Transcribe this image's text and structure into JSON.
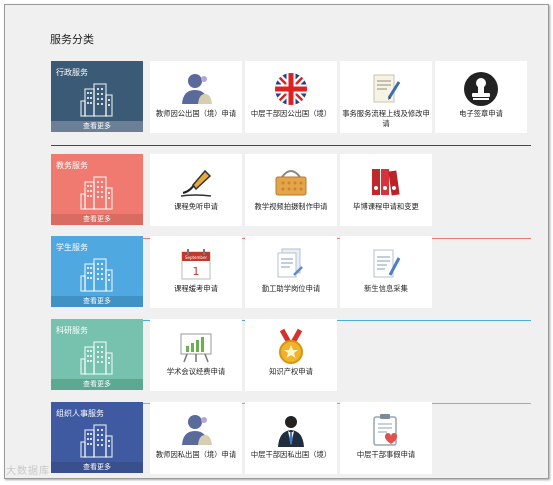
{
  "page_title": "服务分类",
  "sections": [
    {
      "name": "行政服务",
      "more": "查看更多",
      "color": "#3b5a76",
      "more_color": "#6b8096",
      "line_color": "#2f4f6c",
      "items": [
        {
          "label": "教师因公出国（境）申请",
          "icon": "person-icon"
        },
        {
          "label": "中层干部因公出国（境）",
          "icon": "union-jack-icon"
        },
        {
          "label": "事务服务流程上线及修改申请",
          "icon": "document-pen-icon"
        },
        {
          "label": "电子签章申请",
          "icon": "stamp-icon"
        }
      ]
    },
    {
      "name": "教务服务",
      "more": "查看更多",
      "color": "#f07a70",
      "more_color": "#d96b62",
      "line_color": "#f07a70",
      "items": [
        {
          "label": "课程免听申请",
          "icon": "pen-nib-icon"
        },
        {
          "label": "教学视频拍摄制作申请",
          "icon": "basket-icon"
        },
        {
          "label": "毕博课程申请和变更",
          "icon": "binders-icon"
        }
      ]
    },
    {
      "name": "学生服务",
      "more": "查看更多",
      "color": "#4fa8df",
      "more_color": "#4091c4",
      "line_color": "#4fa8df",
      "items": [
        {
          "label": "课程缓考申请",
          "icon": "calendar-icon"
        },
        {
          "label": "勤工助学岗位申请",
          "icon": "documents-icon"
        },
        {
          "label": "新生信息采集",
          "icon": "form-pen-icon"
        }
      ]
    },
    {
      "name": "科研服务",
      "more": "查看更多",
      "color": "#76c2ae",
      "more_color": "#5ea892",
      "line_color": "#76c2ae",
      "items": [
        {
          "label": "学术会议经费申请",
          "icon": "chart-board-icon"
        },
        {
          "label": "知识产权申请",
          "icon": "medal-icon"
        }
      ]
    },
    {
      "name": "组织人事服务",
      "more": "查看更多",
      "color": "#3f5aa0",
      "more_color": "#3a508e",
      "line_color": "#3f5aa0",
      "items": [
        {
          "label": "教师因私出国（境）申请",
          "icon": "person-icon"
        },
        {
          "label": "中层干部因私出国（境）",
          "icon": "businessman-icon"
        },
        {
          "label": "中层干部事假申请",
          "icon": "clipboard-heart-icon"
        }
      ]
    }
  ],
  "watermark": "大数据库"
}
